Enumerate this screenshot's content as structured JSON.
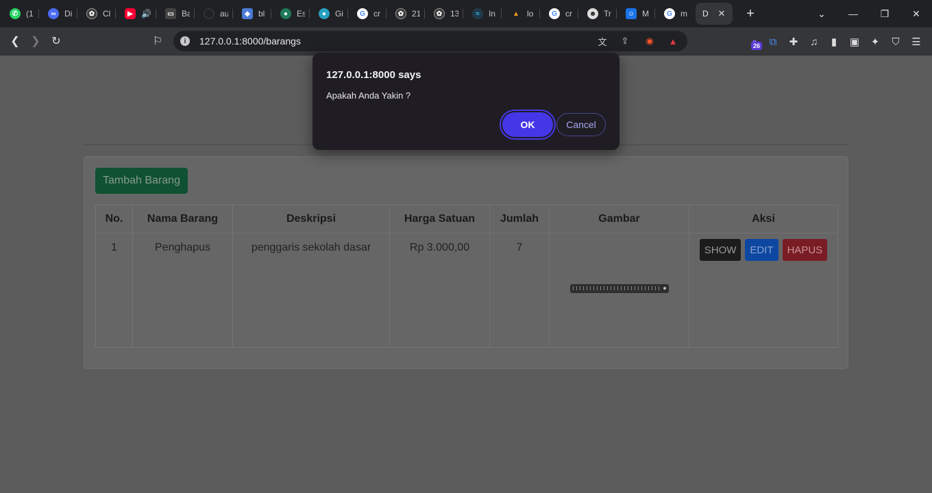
{
  "tabs": [
    {
      "title": "(1",
      "favicon": "whatsapp-icon",
      "color": "#25d366"
    },
    {
      "title": "Di",
      "favicon": "devin-icon",
      "color": "#4a6cf7"
    },
    {
      "title": "Cl",
      "favicon": "chatgpt-icon",
      "color": "#9a9a9a"
    },
    {
      "title": "",
      "favicon": "youtube-icon",
      "color": "#ff0033"
    },
    {
      "title": "Ba",
      "favicon": "tab-icon",
      "color": "#555555"
    },
    {
      "title": "au",
      "favicon": "github-icon",
      "color": "#333333"
    },
    {
      "title": "bl",
      "favicon": "bl-icon",
      "color": "#4a7bd6"
    },
    {
      "title": "Es",
      "favicon": "es-icon",
      "color": "#1e7a5a"
    },
    {
      "title": "Gi",
      "favicon": "gi-icon",
      "color": "#27a0c0"
    },
    {
      "title": "cr",
      "favicon": "google-icon",
      "color": "#4285f4"
    },
    {
      "title": "21",
      "favicon": "chatgpt-icon",
      "color": "#9a9a9a"
    },
    {
      "title": "13",
      "favicon": "chatgpt-icon",
      "color": "#9a9a9a"
    },
    {
      "title": "In",
      "favicon": "tailwind-icon",
      "color": "#38bdf8"
    },
    {
      "title": "lo",
      "favicon": "laravel-icon",
      "color": "#f59e0b"
    },
    {
      "title": "cr",
      "favicon": "google-icon",
      "color": "#4285f4"
    },
    {
      "title": "Tr",
      "favicon": "tr-icon",
      "color": "#dddddd"
    },
    {
      "title": "M",
      "favicon": "m-icon",
      "color": "#1a73e8"
    },
    {
      "title": "m",
      "favicon": "google-icon",
      "color": "#4285f4"
    },
    {
      "title": "D",
      "favicon": "",
      "color": ""
    }
  ],
  "new_tab_label": "+",
  "toolbar": {
    "url": "127.0.0.1:8000/barangs",
    "ext_badge": "26"
  },
  "page": {
    "add_button": "Tambah Barang",
    "columns": [
      "No.",
      "Nama Barang",
      "Deskripsi",
      "Harga Satuan",
      "Jumlah",
      "Gambar",
      "Aksi"
    ],
    "rows": [
      {
        "no": "1",
        "nama": "Penghapus",
        "deskripsi": "penggaris sekolah dasar",
        "harga": "Rp 3.000,00",
        "jumlah": "7"
      }
    ],
    "actions": {
      "show": "SHOW",
      "edit": "EDIT",
      "delete": "HAPUS"
    }
  },
  "dialog": {
    "title": "127.0.0.1:8000 says",
    "message": "Apakah Anda Yakin ?",
    "ok": "OK",
    "cancel": "Cancel"
  }
}
